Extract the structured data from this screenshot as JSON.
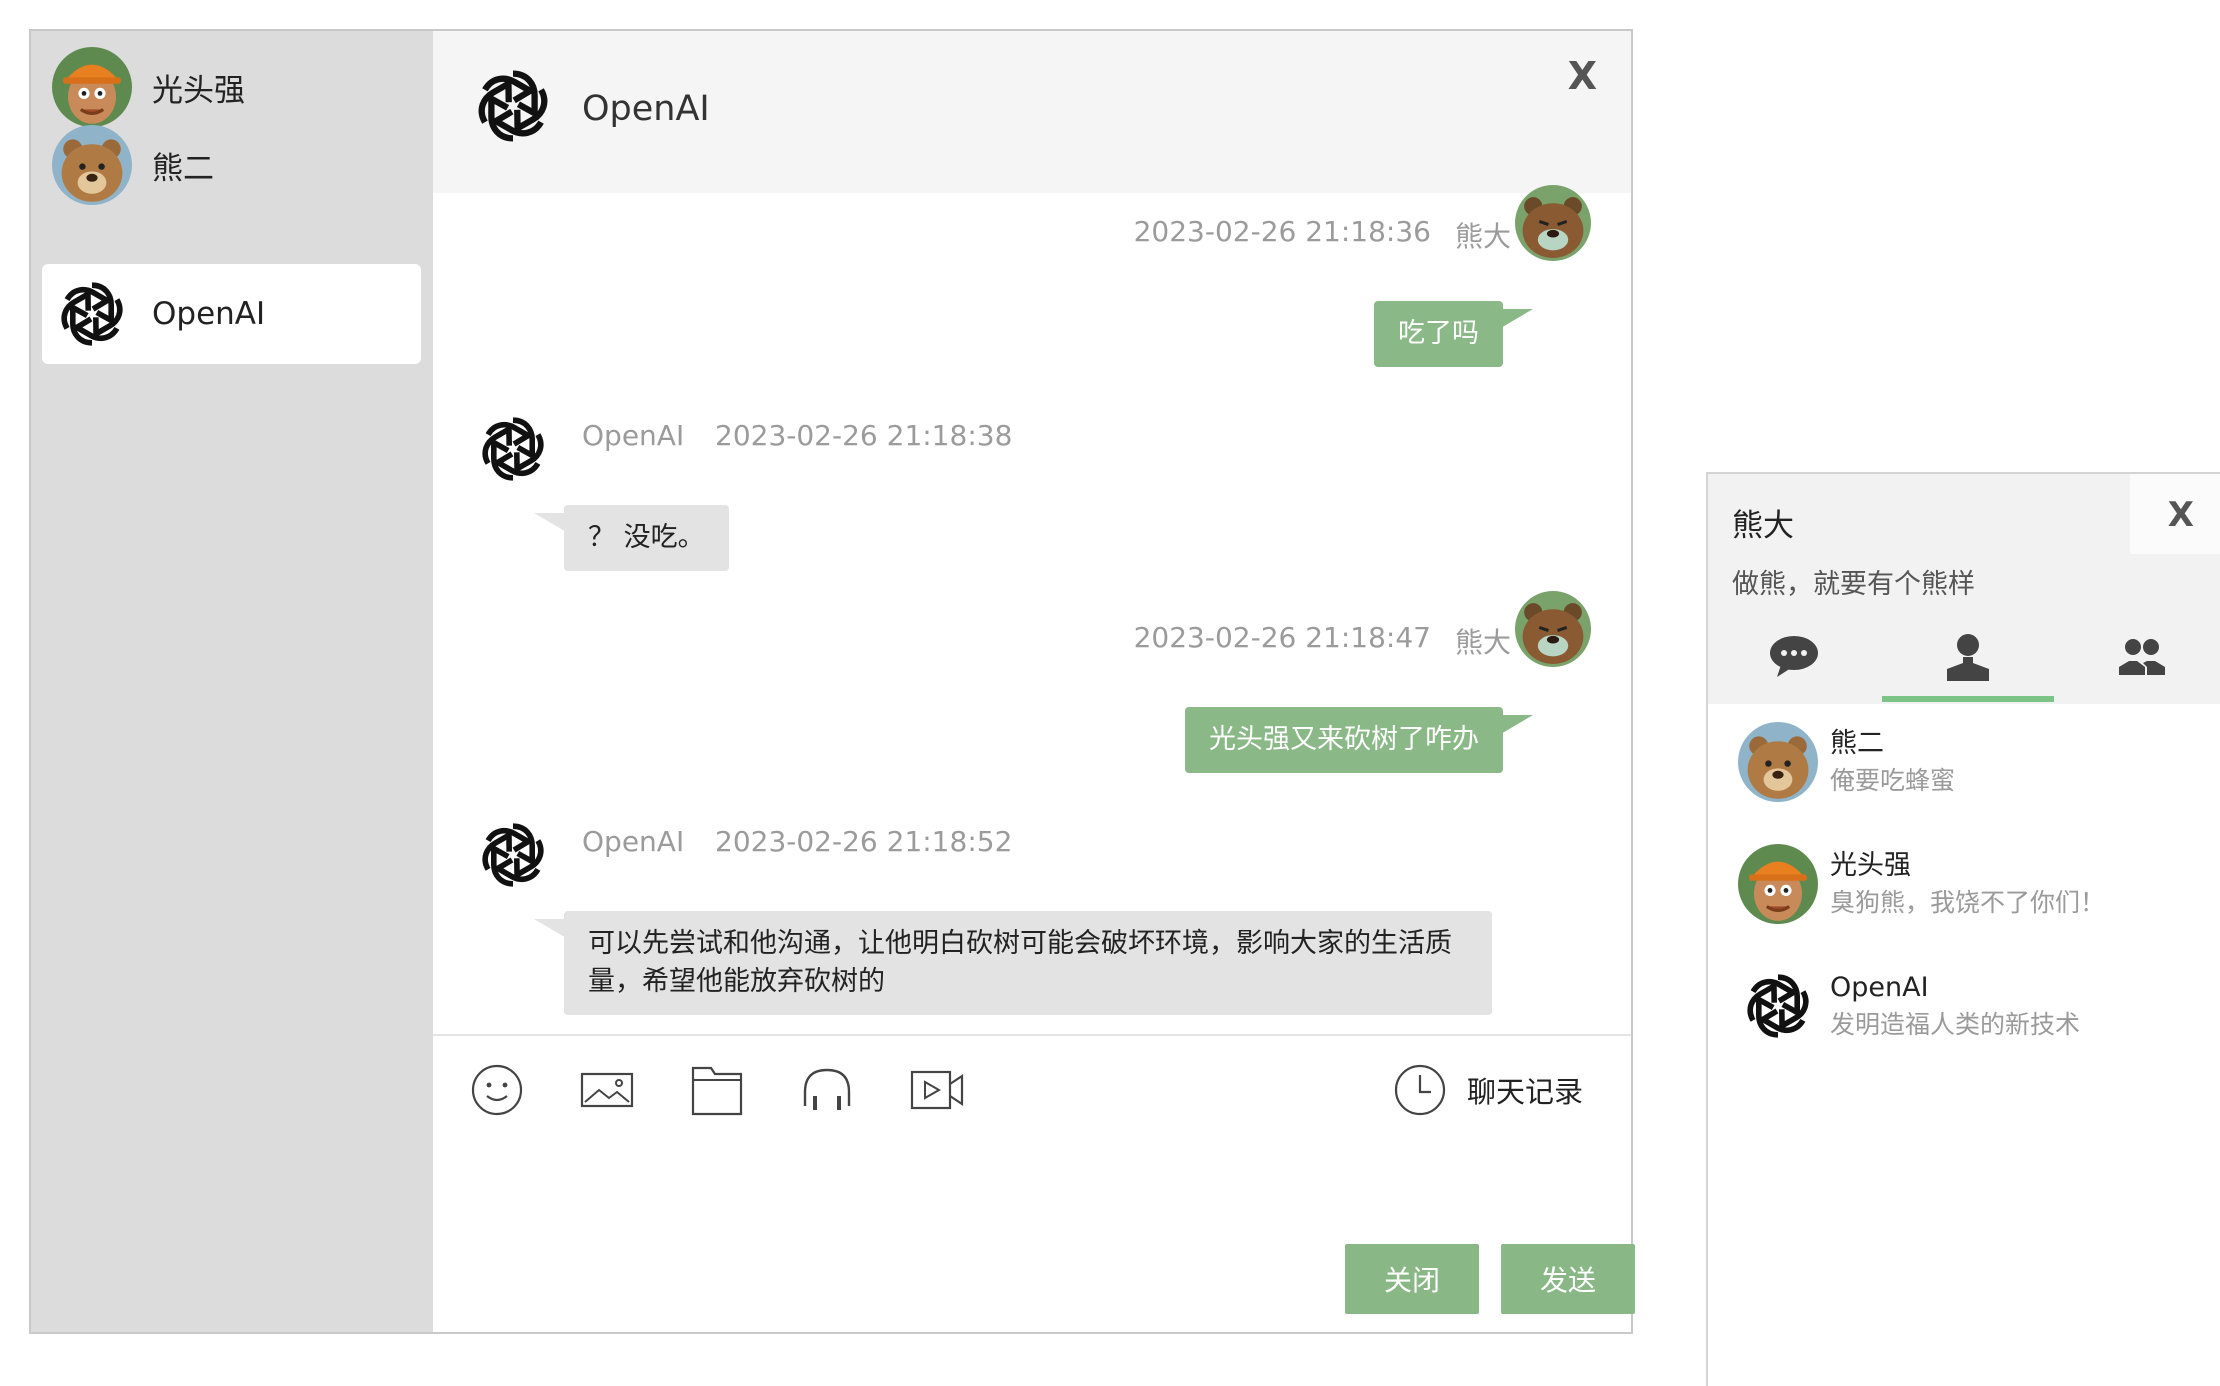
{
  "sessions": [
    {
      "name": "光头强",
      "avatar_icon": "logger-avatar-icon"
    },
    {
      "name": "熊二",
      "avatar_icon": "bear-avatar-icon"
    },
    {
      "name": "OpenAI",
      "avatar_icon": "openai-logo-icon",
      "active": true
    }
  ],
  "conversation": {
    "title": "OpenAI",
    "close_label": "X",
    "messages": [
      {
        "direction": "out",
        "sender": "熊大",
        "time": "2023-02-26 21:18:36",
        "text": "吃了吗"
      },
      {
        "direction": "in",
        "sender": "OpenAI",
        "time": "2023-02-26 21:18:38",
        "text": "？ 没吃。"
      },
      {
        "direction": "out",
        "sender": "熊大",
        "time": "2023-02-26 21:18:47",
        "text": "光头强又来砍树了咋办"
      },
      {
        "direction": "in",
        "sender": "OpenAI",
        "time": "2023-02-26 21:18:52",
        "text": "可以先尝试和他沟通，让他明白砍树可能会破坏环境，影响大家的生活质量，希望他能放弃砍树的"
      }
    ]
  },
  "toolbar": {
    "tools": [
      "emoji-icon",
      "image-icon",
      "folder-icon",
      "headphones-icon",
      "video-icon"
    ],
    "history_label": "聊天记录",
    "close_label": "关闭",
    "send_label": "发送"
  },
  "profile": {
    "name": "熊大",
    "signature": "做熊，就要有个熊样",
    "close_label": "X",
    "tabs": [
      "chat-bubble-icon",
      "person-icon",
      "group-icon"
    ],
    "active_tab": 1,
    "contacts": [
      {
        "name": "熊二",
        "signature": "俺要吃蜂蜜",
        "avatar_icon": "bear-avatar-icon"
      },
      {
        "name": "光头强",
        "signature": "臭狗熊，我饶不了你们！",
        "avatar_icon": "logger-avatar-icon"
      },
      {
        "name": "OpenAI",
        "signature": "发明造福人类的新技术",
        "avatar_icon": "openai-logo-icon"
      }
    ]
  },
  "colors": {
    "accent_green": "#89b886",
    "tab_underline": "#7cc486",
    "sidebar_bg": "#dcdcdc",
    "incoming_bubble": "#e3e3e3"
  }
}
